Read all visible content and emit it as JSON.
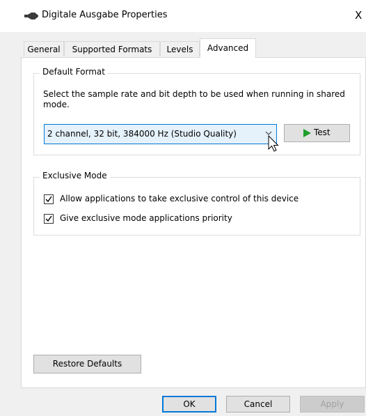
{
  "window": {
    "title": "Digitale Ausgabe Properties",
    "close_glyph": "X"
  },
  "tabs": [
    {
      "label": "General"
    },
    {
      "label": "Supported Formats"
    },
    {
      "label": "Levels"
    },
    {
      "label": "Advanced",
      "active": true
    }
  ],
  "default_format": {
    "legend": "Default Format",
    "description": "Select the sample rate and bit depth to be used when running in shared mode.",
    "selected_format": "2 channel, 32 bit, 384000 Hz (Studio Quality)",
    "test_label": "Test"
  },
  "exclusive_mode": {
    "legend": "Exclusive Mode",
    "options": [
      {
        "label": "Allow applications to take exclusive control of this device",
        "checked": true
      },
      {
        "label": "Give exclusive mode applications priority",
        "checked": true
      }
    ]
  },
  "buttons": {
    "restore_defaults": "Restore Defaults",
    "ok": "OK",
    "cancel": "Cancel",
    "apply": "Apply"
  },
  "colors": {
    "accent": "#0078d7",
    "play_green": "#1f9e2a"
  },
  "icons": {
    "speaker": "speaker-icon",
    "play": "play-icon",
    "dropdown": "chevron-down-icon",
    "cursor": "mouse-cursor-icon"
  }
}
